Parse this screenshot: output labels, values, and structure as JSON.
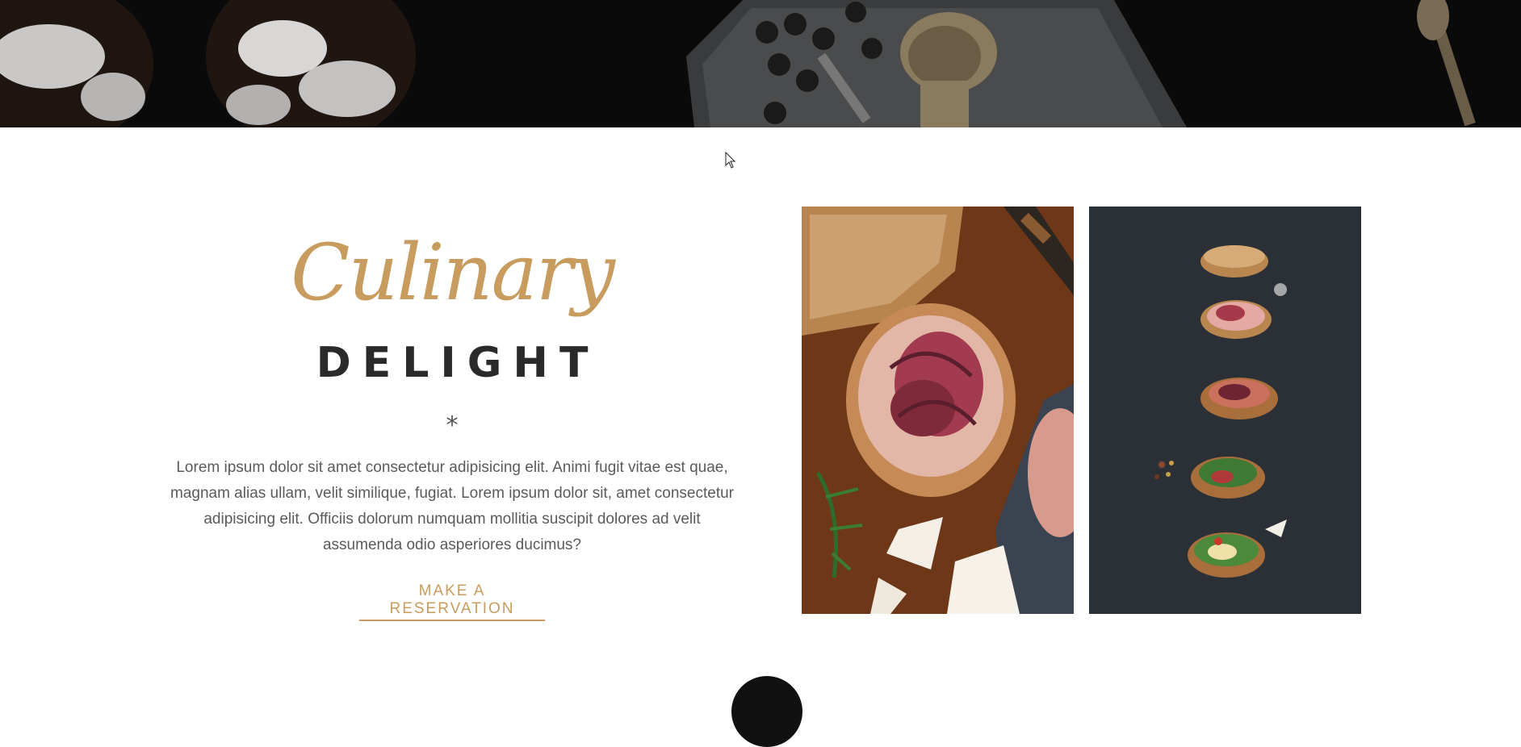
{
  "hero": {
    "image": "dark-food-banner"
  },
  "intro": {
    "script_title": "Culinary",
    "bold_title": "DELIGHT",
    "ornament": "*",
    "body": "Lorem ipsum dolor sit amet consectetur adipisicing elit. Animi fugit vitae est quae, magnam alias ullam, velit similique, fugiat. Lorem ipsum dolor sit, amet consectetur adipisicing elit. Officiis dolorum numquam mollitia suscipit dolores ad velit assumenda odio asperiores ducimus?",
    "cta_label": "MAKE A RESERVATION"
  },
  "photos": [
    {
      "image": "prosciutto-bruschetta-board"
    },
    {
      "image": "bruschetta-row-on-slate"
    }
  ],
  "colors": {
    "accent": "#c89c5e",
    "dark": "#2a2a2a",
    "text": "#5a5a5a"
  }
}
